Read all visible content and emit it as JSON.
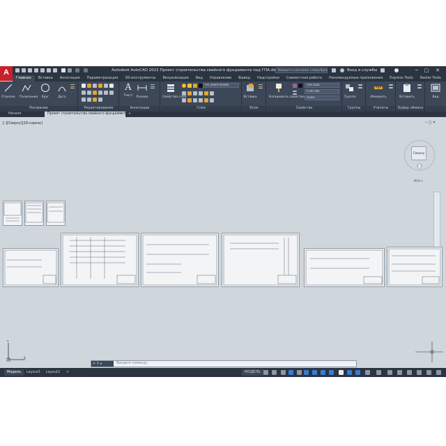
{
  "app": {
    "logo_letter": "A",
    "title": "Autodesk AutoCAD 2022  Проект строительства свайного фундамента под ГПА.dwg",
    "search_placeholder": "Введите ключевое слово/фразу",
    "signin": "Вход в службы",
    "window_buttons": [
      "─",
      "□",
      "✕"
    ]
  },
  "ribbon_tabs": [
    "Главная",
    "Вставка",
    "Аннотации",
    "Параметризация",
    "3D-инструменты",
    "Визуализация",
    "Вид",
    "Управление",
    "Вывод",
    "Надстройки",
    "Совместная работа",
    "Рекомендуемые приложения",
    "Express Tools",
    "Raster Tools"
  ],
  "active_ribbon_tab": "Главная",
  "panels": {
    "draw": {
      "title": "Рисование",
      "tools": [
        "Отрезок",
        "Полилиния",
        "Круг",
        "Дуга"
      ]
    },
    "modify": {
      "title": "Редактирование"
    },
    "annotation": {
      "title": "Аннотации",
      "tools": [
        "Текст",
        "Размер"
      ]
    },
    "layers": {
      "title": "Слои",
      "tool": "Свойства слоя",
      "layer_combo": "По умолчанию"
    },
    "block": {
      "title": "Блок",
      "tool": "Вставка"
    },
    "properties": {
      "title": "Свойства",
      "tool": "Копировать свойства",
      "color": "ПоСлою",
      "lineweight": "0.00 мм",
      "linetype": "Solid ..."
    },
    "groups": {
      "title": "Группы",
      "tool": "Группа"
    },
    "utilities": {
      "title": "Утилиты",
      "tool": "Измерить"
    },
    "clipboard": {
      "title": "Буфер обмена",
      "tool": "Вставить"
    },
    "view": {
      "title": "",
      "tool": "Вид"
    }
  },
  "file_tabs": [
    "Начало",
    "Проект строительства свайного фундамента под ГПА"
  ],
  "viewport_label": "[–][Сверху][2D-каркас]",
  "viewcube": {
    "face": "Сверху",
    "wcs": "МСК ▾"
  },
  "command_line": {
    "controls": "✕ ⚲ ▸",
    "prompt": "Введите команду"
  },
  "layout_tabs": [
    "Модель",
    "Layout1",
    "Layout2"
  ],
  "active_layout": "Модель",
  "status_mode": "МОДЕЛЬ",
  "colors": {
    "ribbon_bg": "#3c4758",
    "titlebar_bg": "#2b3441",
    "drawing_bg": "#cfd6dc",
    "accent_red": "#c8202c",
    "active_blue": "#3a7bd5"
  }
}
